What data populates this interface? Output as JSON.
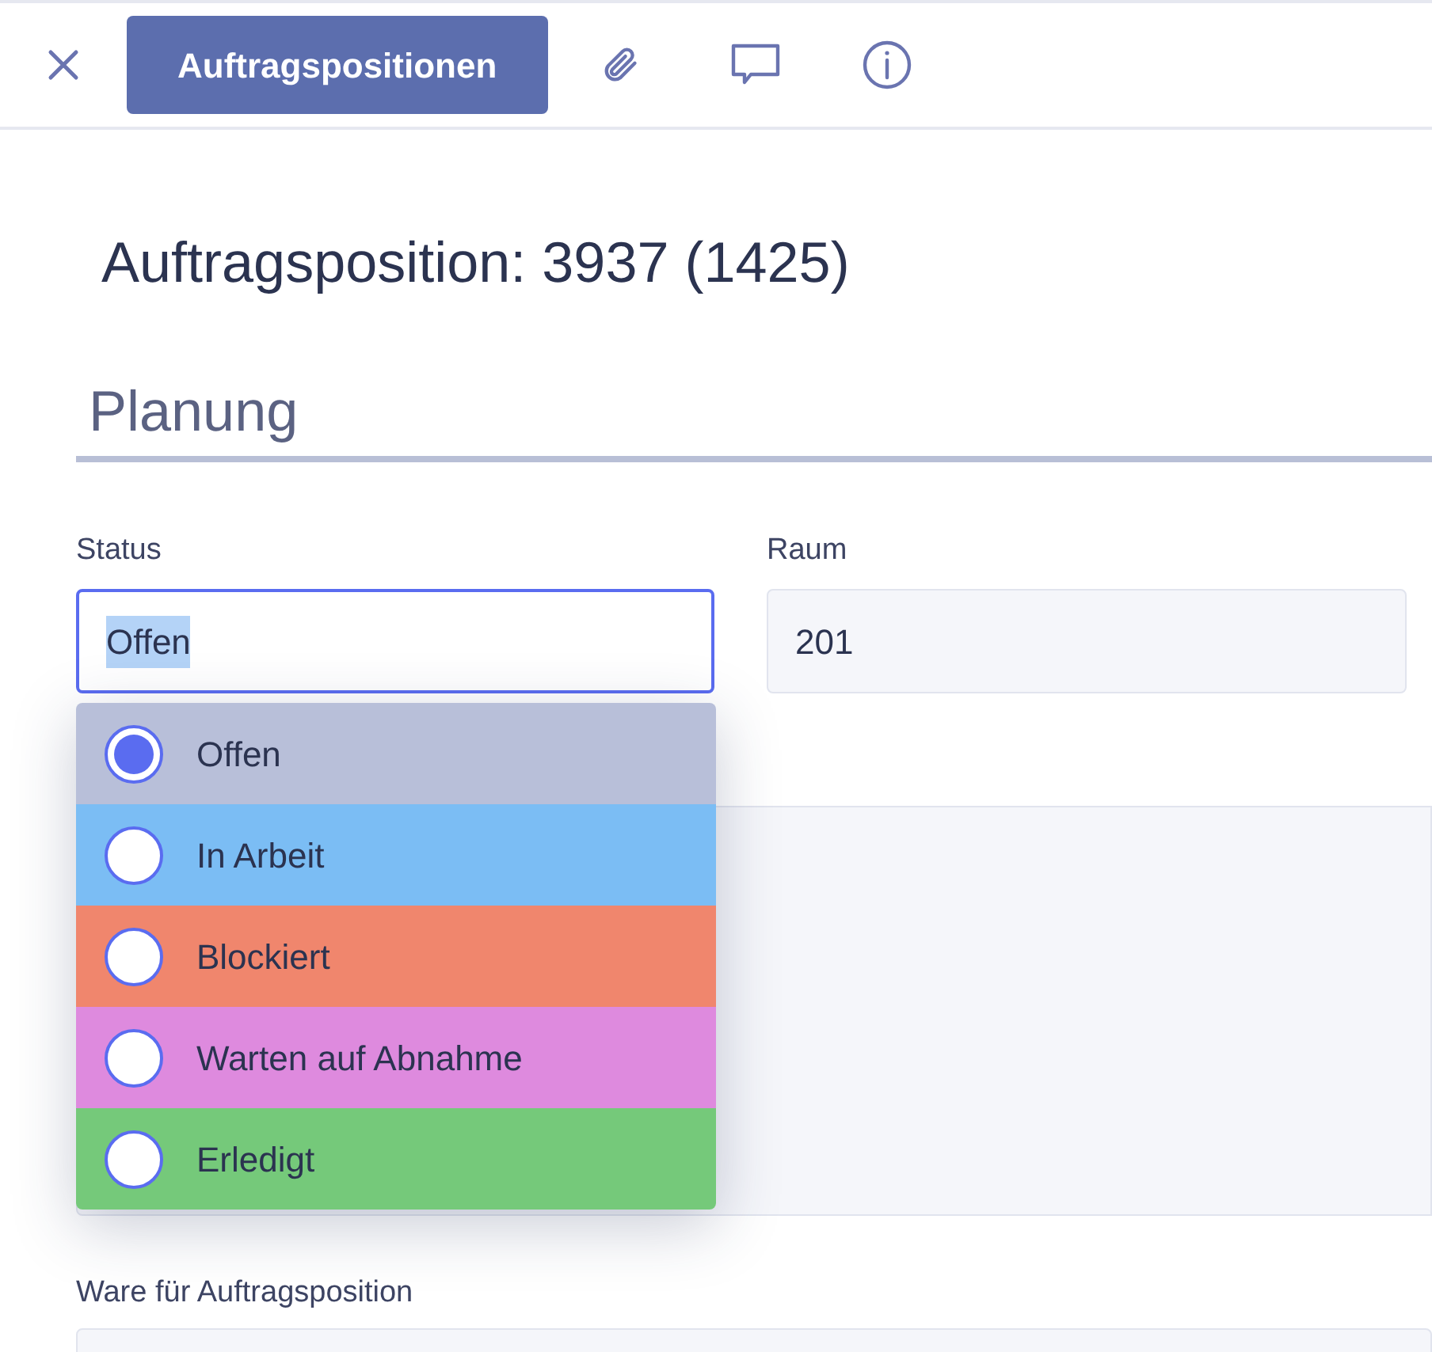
{
  "toolbar": {
    "tab_label": "Auftragspositionen"
  },
  "title": "Auftragsposition: 3937 (1425)",
  "section": "Planung",
  "status_field": {
    "label": "Status",
    "value": "Offen",
    "expanded": true
  },
  "room_field": {
    "label": "Raum",
    "value": "201"
  },
  "status_options": [
    {
      "label": "Offen",
      "color": "#b8bfd9",
      "selected": true
    },
    {
      "label": "In Arbeit",
      "color": "#7bbdf4",
      "selected": false
    },
    {
      "label": "Blockiert",
      "color": "#f0866d",
      "selected": false
    },
    {
      "label": "Warten auf Abnahme",
      "color": "#de8ade",
      "selected": false
    },
    {
      "label": "Erledigt",
      "color": "#75c97a",
      "selected": false
    }
  ],
  "goods_field": {
    "label": "Ware für Auftragsposition"
  }
}
